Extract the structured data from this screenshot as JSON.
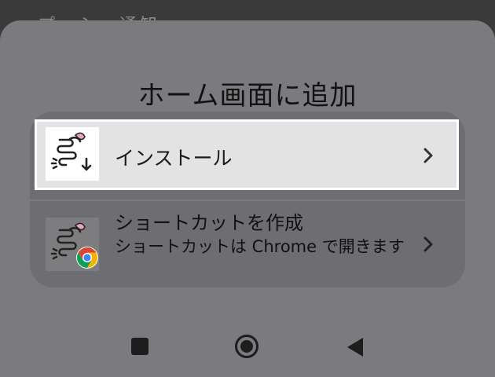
{
  "background_strip": {
    "text": "プッシュ通知"
  },
  "sheet": {
    "title": "ホーム画面に追加",
    "options": [
      {
        "label": "インストール",
        "icon": "app-icon-intestine-download",
        "chevron": "chevron-right-icon"
      },
      {
        "title": "ショートカットを作成",
        "description": "ショートカットは Chrome で開きます",
        "icon": "app-icon-intestine-chrome",
        "chevron": "chevron-right-icon"
      }
    ]
  },
  "navigation": {
    "recents": "square-icon",
    "home": "circle-icon",
    "back": "triangle-back-icon"
  },
  "colors": {
    "sheet": "#7b7a7f",
    "card": "#6e6e72",
    "highlight": "#e3e3e3",
    "accent_pink": "#e8a3bd"
  }
}
